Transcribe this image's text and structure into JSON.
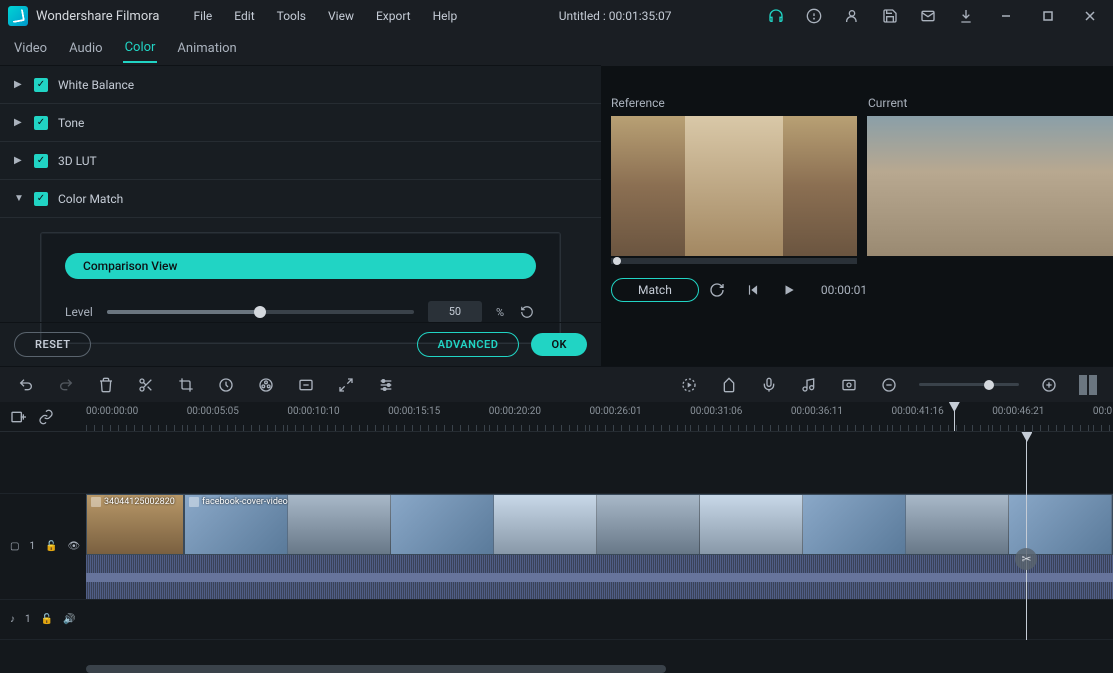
{
  "app": {
    "name": "Wondershare Filmora",
    "title": "Untitled : 00:01:35:07"
  },
  "menu": {
    "file": "File",
    "edit": "Edit",
    "tools": "Tools",
    "view": "View",
    "export": "Export",
    "help": "Help"
  },
  "tabs": {
    "video": "Video",
    "audio": "Audio",
    "color": "Color",
    "animation": "Animation"
  },
  "accordion": {
    "white_balance": "White Balance",
    "tone": "Tone",
    "lut": "3D LUT",
    "color_match": "Color Match"
  },
  "color_match": {
    "comparison_btn": "Comparison View",
    "level_label": "Level",
    "level_value": "50",
    "pct": "%"
  },
  "footer": {
    "reset": "RESET",
    "advanced": "ADVANCED",
    "ok": "OK"
  },
  "preview": {
    "reference": "Reference",
    "current": "Current",
    "match": "Match",
    "timecode": "00:00:01"
  },
  "ruler": [
    "00:00:00:00",
    "00:00:05:05",
    "00:00:10:10",
    "00:00:15:15",
    "00:00:20:20",
    "00:00:26:01",
    "00:00:31:06",
    "00:00:36:11",
    "00:00:41:16",
    "00:00:46:21",
    "00:0"
  ],
  "clips": {
    "c1": "34044125002820",
    "c2": "facebook-cover-video"
  },
  "tracks": {
    "v1": "1",
    "a1": "1"
  }
}
